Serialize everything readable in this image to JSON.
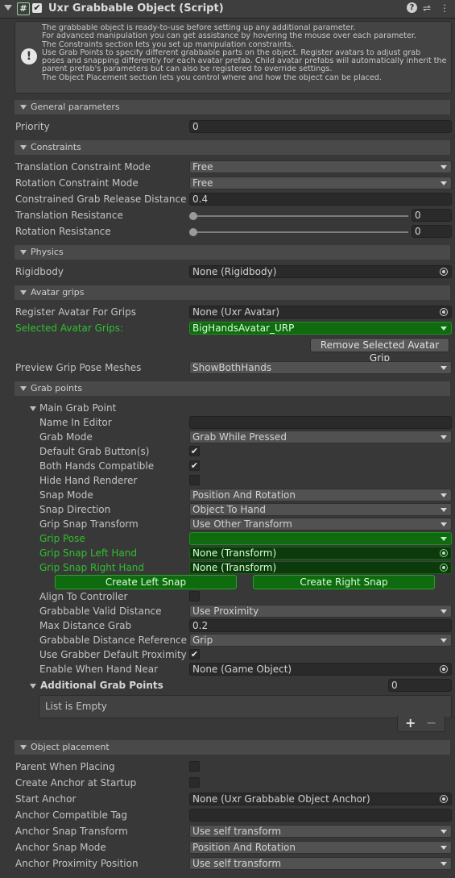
{
  "header": {
    "title": "Uxr Grabbable Object (Script)",
    "script_glyph": "#",
    "enabled_glyph": "✔",
    "help_glyph": "?",
    "presets_glyph": "⇌",
    "menu_glyph": "⋮"
  },
  "help": {
    "icon": "!",
    "lines": [
      "The grabbable object is ready-to-use before setting up any additional parameter.",
      "For advanced manipulation you can get assistance by hovering the mouse over each parameter.",
      "The Constraints section lets you set up manipulation constraints.",
      "Use Grab Points to specify different grabbable parts on the object. Register avatars to adjust grab",
      "poses and snapping differently for each avatar prefab. Child avatar prefabs will automatically inherit the",
      "parent prefab's parameters but can also be registered to override settings.",
      "The Object Placement section lets you control where and how the object can be placed."
    ]
  },
  "sections": {
    "general": "General parameters",
    "constraints": "Constraints",
    "physics": "Physics",
    "avatar_grips": "Avatar grips",
    "grab_points": "Grab points",
    "placement": "Object placement"
  },
  "general": {
    "priority_label": "Priority",
    "priority_value": "0"
  },
  "constraints": {
    "translation_mode_label": "Translation Constraint Mode",
    "translation_mode_value": "Free",
    "rotation_mode_label": "Rotation Constraint Mode",
    "rotation_mode_value": "Free",
    "release_label": "Constrained Grab Release Distance",
    "release_value": "0.4",
    "tres_label": "Translation Resistance",
    "tres_value": "0",
    "rres_label": "Rotation Resistance",
    "rres_value": "0"
  },
  "physics": {
    "rigidbody_label": "Rigidbody",
    "rigidbody_value": "None (Rigidbody)"
  },
  "avatar": {
    "register_label": "Register Avatar For Grips",
    "register_value": "None (Uxr Avatar)",
    "selected_label": "Selected Avatar Grips:",
    "selected_value": "BigHandsAvatar_URP",
    "remove_button": "Remove Selected Avatar Grip",
    "preview_label": "Preview Grip Pose Meshes",
    "preview_value": "ShowBothHands"
  },
  "grab": {
    "main_label": "Main Grab Point",
    "name_label": "Name In Editor",
    "name_value": "",
    "mode_label": "Grab Mode",
    "mode_value": "Grab While Pressed",
    "default_btn_label": "Default Grab Button(s)",
    "default_btn_checked": "✔",
    "both_hands_label": "Both Hands Compatible",
    "both_hands_checked": "✔",
    "hide_hand_label": "Hide Hand Renderer",
    "hide_hand_checked": "",
    "snap_mode_label": "Snap Mode",
    "snap_mode_value": "Position And Rotation",
    "snap_dir_label": "Snap Direction",
    "snap_dir_value": "Object To Hand",
    "grip_transform_label": "Grip Snap Transform",
    "grip_transform_value": "Use Other Transform",
    "grip_pose_label": "Grip Pose",
    "grip_pose_value": "",
    "left_label": "Grip Snap Left Hand",
    "left_value": "None (Transform)",
    "right_label": "Grip Snap Right Hand",
    "right_value": "None (Transform)",
    "create_left": "Create Left Snap",
    "create_right": "Create Right Snap",
    "align_label": "Align To Controller",
    "align_checked": "",
    "valid_label": "Grabbable Valid Distance",
    "valid_value": "Use Proximity",
    "maxdist_label": "Max Distance Grab",
    "maxdist_value": "0.2",
    "ref_label": "Grabbable Distance Reference",
    "ref_value": "Grip",
    "grabber_label": "Use Grabber Default Proximity",
    "grabber_checked": "✔",
    "near_label": "Enable When Hand Near",
    "near_value": "None (Game Object)",
    "additional_label": "Additional Grab Points",
    "additional_count": "0",
    "list_empty": "List is Empty",
    "add_glyph": "+",
    "remove_glyph": "−"
  },
  "placement": {
    "parent_label": "Parent When Placing",
    "parent_checked": "",
    "anchor_startup_label": "Create Anchor at Startup",
    "anchor_startup_checked": "",
    "start_anchor_label": "Start Anchor",
    "start_anchor_value": "None (Uxr Grabbable Object Anchor)",
    "tag_label": "Anchor Compatible Tag",
    "tag_value": "",
    "snap_transform_label": "Anchor Snap Transform",
    "snap_transform_value": "Use self transform",
    "snap_mode_label": "Anchor Snap Mode",
    "snap_mode_value": "Position And Rotation",
    "proximity_label": "Anchor Proximity Position",
    "proximity_value": "Use self transform"
  }
}
